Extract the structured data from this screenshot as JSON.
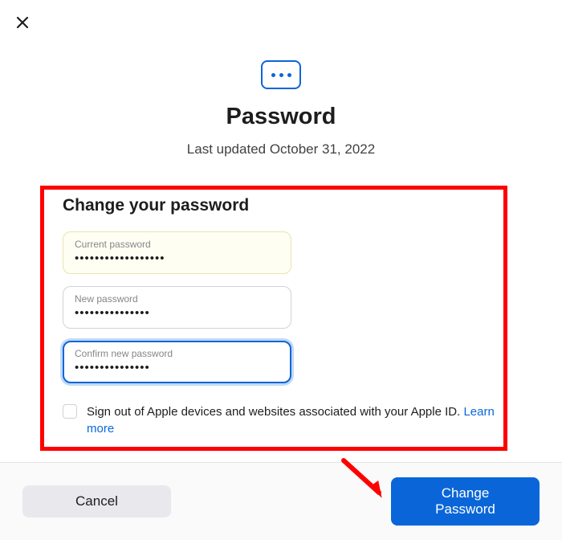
{
  "header": {
    "title": "Password",
    "subtitle": "Last updated October 31, 2022"
  },
  "form": {
    "title": "Change your password",
    "current": {
      "label": "Current password",
      "value": "••••••••••••••••••"
    },
    "newp": {
      "label": "New password",
      "value": "•••••••••••••••"
    },
    "confirm": {
      "label": "Confirm new password",
      "value": "•••••••••••••••"
    },
    "signout_text": "Sign out of Apple devices and websites associated with your Apple ID. ",
    "learn_more": "Learn more"
  },
  "footer": {
    "cancel": "Cancel",
    "change": "Change Password"
  }
}
